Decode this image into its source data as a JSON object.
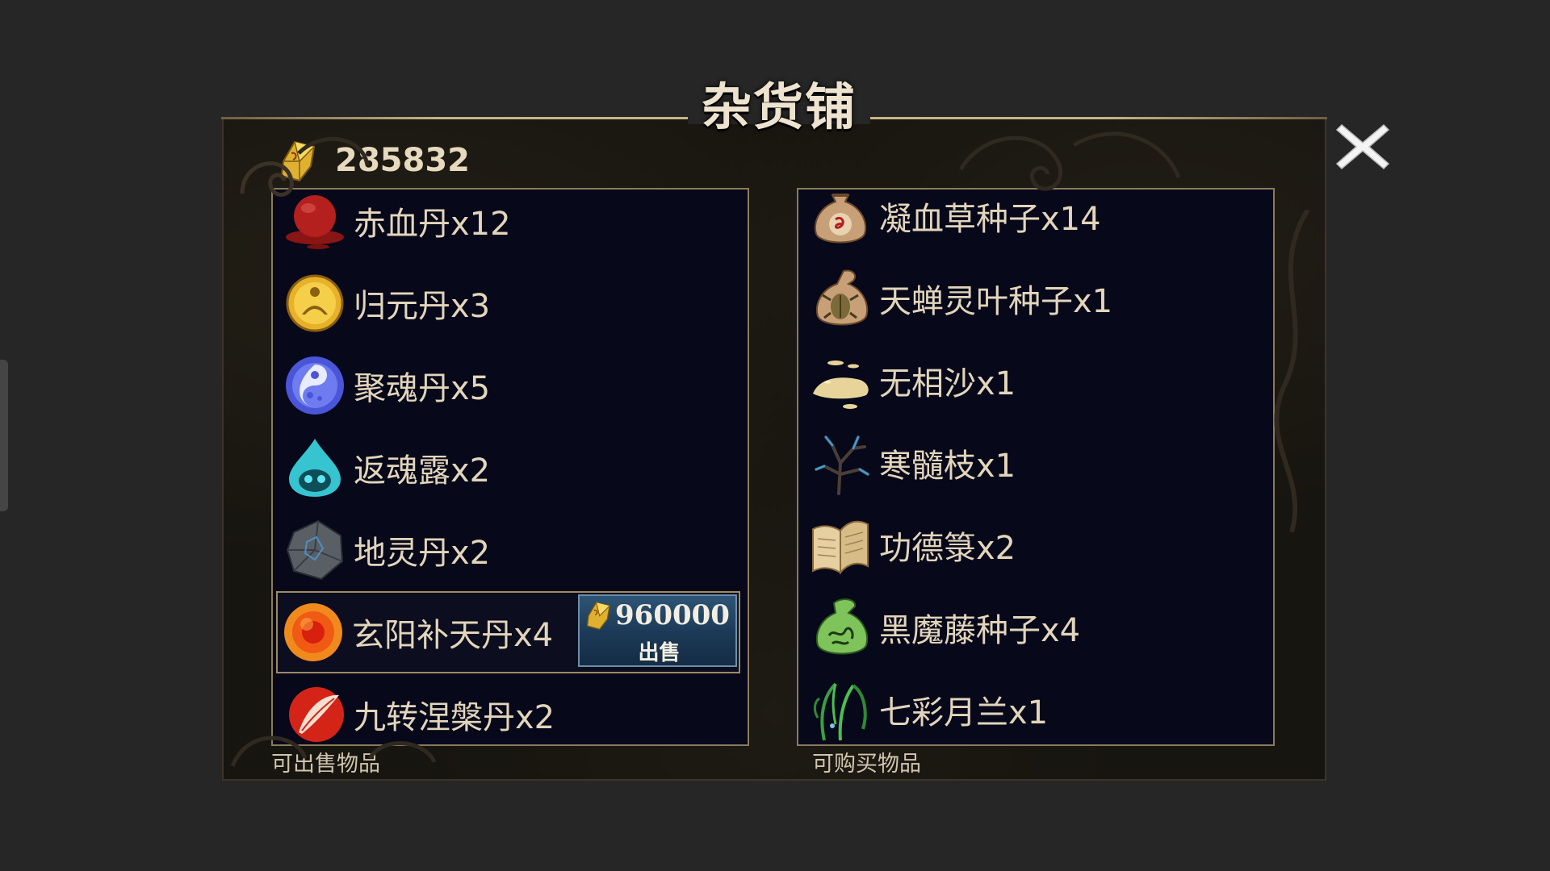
{
  "title": "杂货铺",
  "currency": {
    "amount": "285832",
    "icon": "gold-ingot-icon"
  },
  "close": {
    "icon": "close-icon"
  },
  "sell_list": {
    "caption": "可出售物品",
    "items": [
      {
        "label": "赤血丹x12",
        "icon": "red-blood-pill-icon"
      },
      {
        "label": "归元丹x3",
        "icon": "golden-meditation-pill-icon"
      },
      {
        "label": "聚魂丹x5",
        "icon": "blue-soul-pill-icon"
      },
      {
        "label": "返魂露x2",
        "icon": "cyan-skull-drop-icon"
      },
      {
        "label": "地灵丹x2",
        "icon": "stone-rune-pill-icon"
      },
      {
        "label": "玄阳补天丹x4",
        "icon": "orange-sun-pill-icon",
        "selected": true,
        "price": "960000",
        "action": "出售"
      },
      {
        "label": "九转涅槃丹x2",
        "icon": "phoenix-feather-pill-icon"
      }
    ]
  },
  "buy_list": {
    "caption": "可购买物品",
    "items": [
      {
        "label": "凝血草种子x14",
        "icon": "seed-bag-red-rune-icon"
      },
      {
        "label": "天蝉灵叶种子x1",
        "icon": "seed-bag-cicada-icon"
      },
      {
        "label": "无相沙x1",
        "icon": "sand-pile-icon"
      },
      {
        "label": "寒髓枝x1",
        "icon": "frost-branch-icon"
      },
      {
        "label": "功德箓x2",
        "icon": "scroll-book-icon"
      },
      {
        "label": "黑魔藤种子x4",
        "icon": "green-seed-bag-icon"
      },
      {
        "label": "七彩月兰x1",
        "icon": "moon-orchid-icon"
      }
    ]
  },
  "colors": {
    "background": "#262626",
    "panel": "#17150f",
    "list_bg": "#07081a",
    "text": "#e2d5bb",
    "sell_button": "#1b3956"
  }
}
